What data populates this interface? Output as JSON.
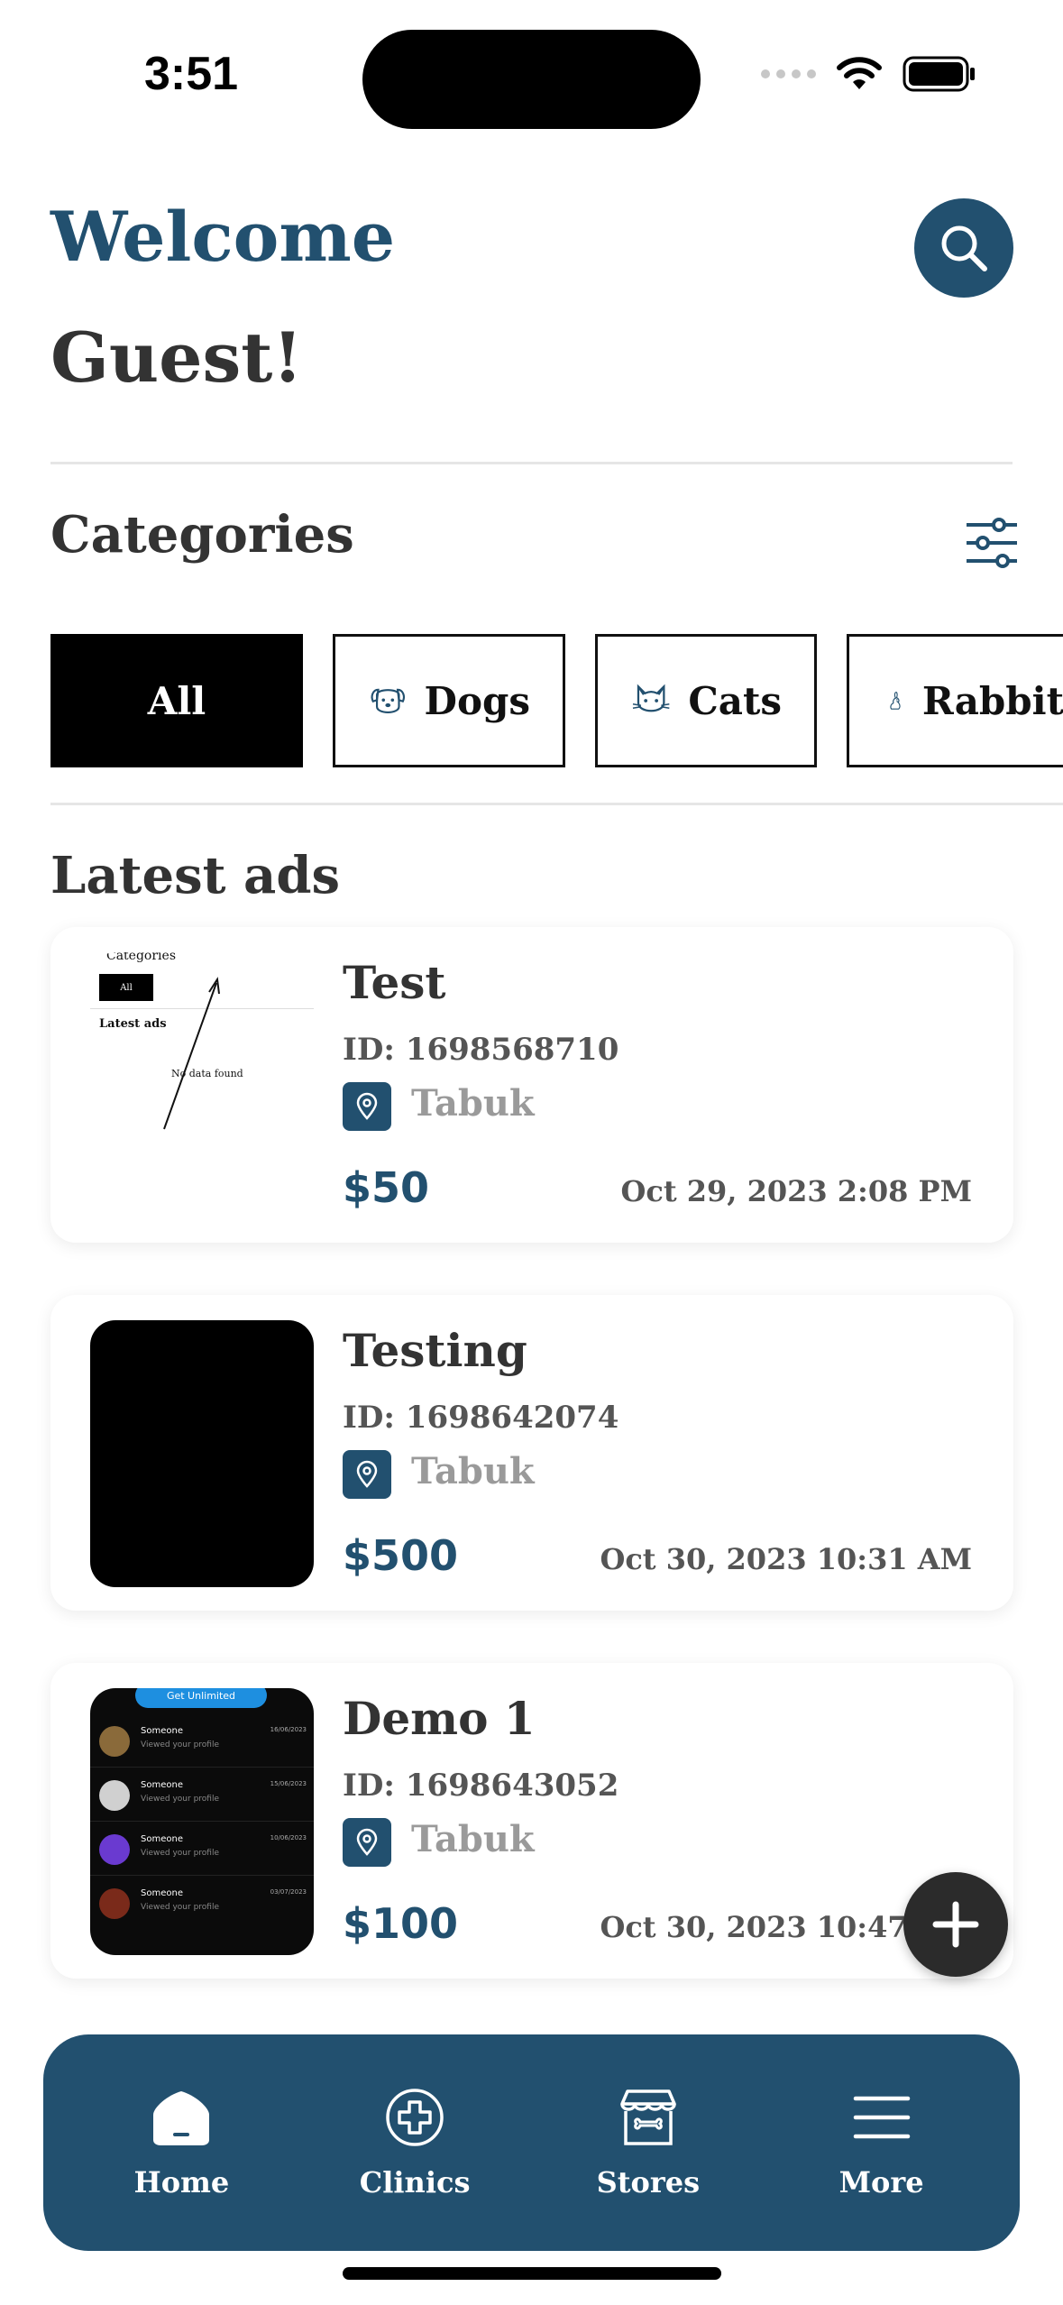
{
  "status": {
    "time": "3:51"
  },
  "header": {
    "welcome": "Welcome",
    "guest": "Guest!"
  },
  "categories": {
    "title": "Categories",
    "chips": [
      {
        "label": "All",
        "icon": "none",
        "active": true
      },
      {
        "label": "Dogs",
        "icon": "dog-icon"
      },
      {
        "label": "Cats",
        "icon": "cat-icon"
      },
      {
        "label": "Rabbit",
        "icon": "rabbit-icon"
      }
    ]
  },
  "latest": {
    "title": "Latest ads",
    "ads": [
      {
        "title": "Test",
        "id_label": "ID:",
        "id": "1698568710",
        "location": "Tabuk",
        "price": "$50",
        "date": "Oct 29, 2023 2:08 PM"
      },
      {
        "title": "Testing",
        "id_label": "ID:",
        "id": "1698642074",
        "location": "Tabuk",
        "price": "$500",
        "date": "Oct 30, 2023 10:31 AM"
      },
      {
        "title": "Demo 1",
        "id_label": "ID:",
        "id": "1698643052",
        "location": "Tabuk",
        "price": "$100",
        "date": "Oct 30, 2023 10:47 AM"
      }
    ],
    "thumb1": {
      "categories": "Categories",
      "all": "All",
      "latest_ads": "Latest ads",
      "no_data": "No data found"
    },
    "thumb3": {
      "banner": "Get Unlimited",
      "rows": [
        {
          "name": "Someone",
          "sub": "Viewed your profile",
          "date": "16/06/2023"
        },
        {
          "name": "Someone",
          "sub": "Viewed your profile",
          "date": "15/06/2023"
        },
        {
          "name": "Someone",
          "sub": "Viewed your profile",
          "date": "10/06/2023"
        },
        {
          "name": "Someone",
          "sub": "Viewed your profile",
          "date": "03/07/2023"
        }
      ]
    }
  },
  "nav": {
    "items": [
      {
        "label": "Home",
        "icon": "home-icon"
      },
      {
        "label": "Clinics",
        "icon": "clinic-plus-icon"
      },
      {
        "label": "Stores",
        "icon": "store-icon"
      },
      {
        "label": "More",
        "icon": "menu-icon"
      }
    ]
  },
  "colors": {
    "primary": "#22506f",
    "text": "#333333",
    "muted": "#9a9a9a"
  }
}
